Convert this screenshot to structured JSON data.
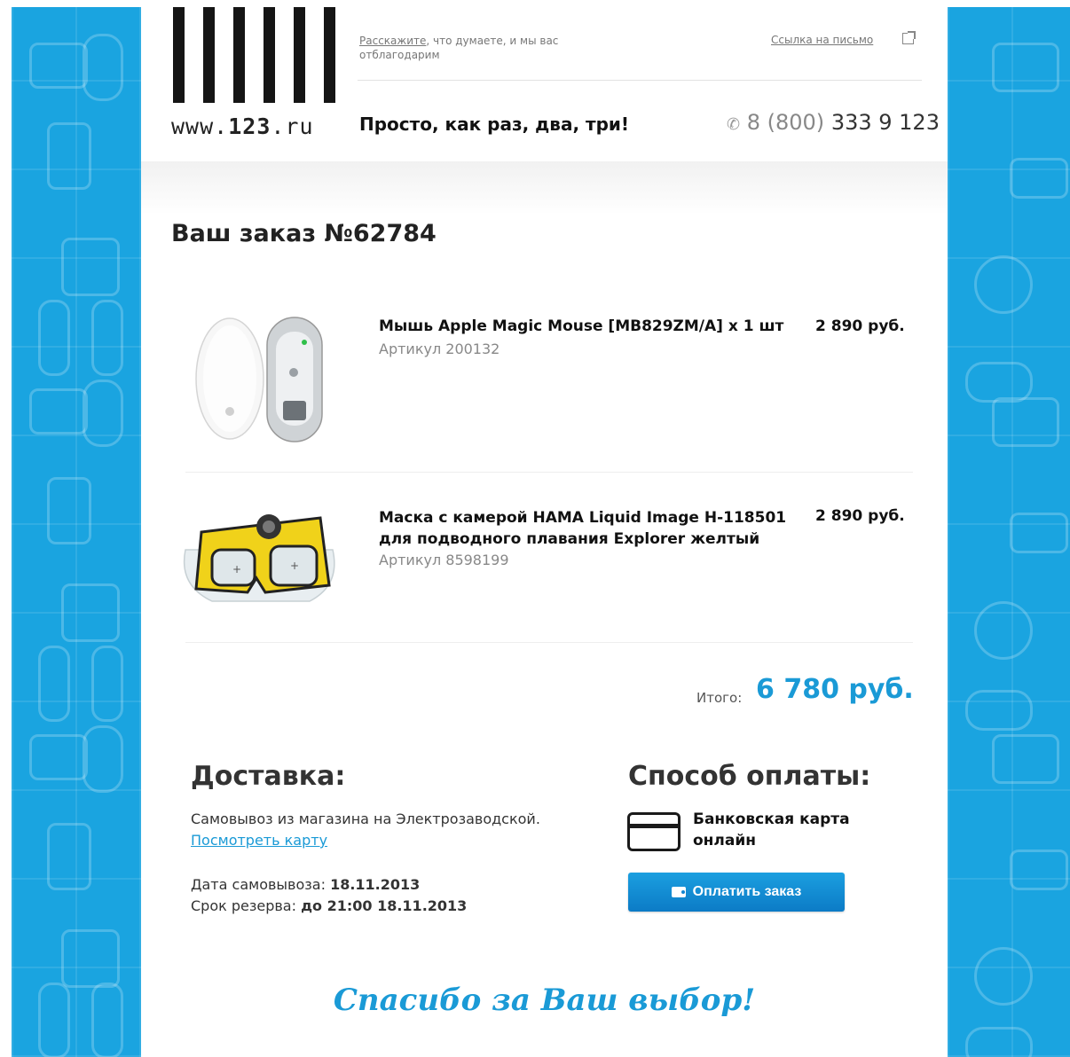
{
  "header": {
    "logo_url_prefix": "www.",
    "logo_url_number": "123",
    "logo_url_suffix": ".ru",
    "feedback_link": "Расскажите",
    "feedback_rest": ", что думаете, и мы вас отблагодарим",
    "web_version_link": "Ссылка на письмо",
    "tagline": "Просто, как раз, два, три!",
    "phone_prefix": "8 (800)",
    "phone_number": "333 9 123"
  },
  "order": {
    "title": "Ваш заказ №62784",
    "items": [
      {
        "name": "Мышь Apple Magic Mouse [MB829ZM/A] x 1 шт",
        "sku": "Артикул 200132",
        "price": "2 890 руб.",
        "image_icon": "mouse-product-image"
      },
      {
        "name": "Маска с камерой HAMA Liquid Image H-118501 для подводного плавания Explorer желтый",
        "sku": "Артикул 8598199",
        "price": "2 890 руб.",
        "image_icon": "dive-mask-product-image"
      }
    ],
    "total_label": "Итого:",
    "total_value": "6 780 руб."
  },
  "delivery": {
    "title": "Доставка:",
    "text": "Самовывоз из магазина на Электрозаводской.",
    "map_link": "Посмотреть карту",
    "pickup_date_label": "Дата самовывоза:",
    "pickup_date": "18.11.2013",
    "reserve_label": "Срок резерва:",
    "reserve_value": "до 21:00 18.11.2013"
  },
  "payment": {
    "title": "Способ оплаты:",
    "method": "Банковская карта онлайн",
    "button_label": "Оплатить заказ"
  },
  "footer": {
    "thanks": "Спасибо за Ваш выбор!"
  },
  "colors": {
    "side_background": "#1aa4e0",
    "accent": "#1a9ad6",
    "button": "#1186d2"
  }
}
